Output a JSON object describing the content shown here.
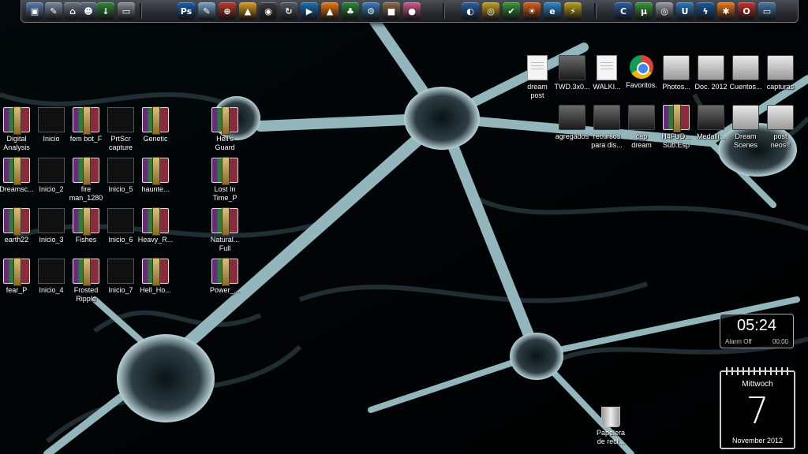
{
  "dock": {
    "icons": [
      {
        "name": "computer-icon",
        "glyph": "▣",
        "color": "#5a7fb0"
      },
      {
        "name": "notes-icon",
        "glyph": "✎",
        "color": "#7a8aa0"
      },
      {
        "name": "network-icon",
        "glyph": "⌂",
        "color": "#6c7480"
      },
      {
        "name": "user-icon",
        "glyph": "☻",
        "color": "#5f6f8a"
      },
      {
        "name": "download-icon",
        "glyph": "↓",
        "color": "#2e8b3a"
      },
      {
        "name": "drive-icon",
        "glyph": "▭",
        "color": "#8a8f96"
      },
      {
        "name": "photoshop-icon",
        "glyph": "Ps",
        "color": "#1b5fb3"
      },
      {
        "name": "notepad-icon",
        "glyph": "✎",
        "color": "#7aa3c8"
      },
      {
        "name": "media-center-icon",
        "glyph": "⊕",
        "color": "#c0392b"
      },
      {
        "name": "aimp-icon",
        "glyph": "▲",
        "color": "#e0a020"
      },
      {
        "name": "eye-icon",
        "glyph": "◉",
        "color": "#3a3a3a"
      },
      {
        "name": "refresh-icon",
        "glyph": "↻",
        "color": "#555b66"
      },
      {
        "name": "play-icon",
        "glyph": "▶",
        "color": "#1e6fb8"
      },
      {
        "name": "vlc-icon",
        "glyph": "▲",
        "color": "#f07b10"
      },
      {
        "name": "frog-icon",
        "glyph": "♣",
        "color": "#2a8a3a"
      },
      {
        "name": "settings-icon",
        "glyph": "⚙",
        "color": "#3a7fc0"
      },
      {
        "name": "box-icon",
        "glyph": "■",
        "color": "#8a6a4a"
      },
      {
        "name": "mushroom-icon",
        "glyph": "●",
        "color": "#d05a8a"
      },
      {
        "name": "google-earth-icon",
        "glyph": "◐",
        "color": "#2a5fa8"
      },
      {
        "name": "chrome-icon",
        "glyph": "◎",
        "color": "#c8a020"
      },
      {
        "name": "bookmark-icon",
        "glyph": "✔",
        "color": "#3a9a3a"
      },
      {
        "name": "firefox-icon",
        "glyph": "☀",
        "color": "#e0601a"
      },
      {
        "name": "internet-explorer-icon",
        "glyph": "e",
        "color": "#2a8ad0"
      },
      {
        "name": "winamp-icon",
        "glyph": "⚡",
        "color": "#c0a020"
      },
      {
        "name": "ccleaner-icon",
        "glyph": "C",
        "color": "#2a5fa0"
      },
      {
        "name": "utorrent-icon",
        "glyph": "µ",
        "color": "#3a9a3a"
      },
      {
        "name": "disc-icon",
        "glyph": "◎",
        "color": "#9a9aaa"
      },
      {
        "name": "ultraiso-icon",
        "glyph": "U",
        "color": "#2a7ac0"
      },
      {
        "name": "lightning-icon",
        "glyph": "ϟ",
        "color": "#1a5aa0"
      },
      {
        "name": "avast-icon",
        "glyph": "✱",
        "color": "#f07a1a"
      },
      {
        "name": "opera-icon",
        "glyph": "O",
        "color": "#d03030"
      },
      {
        "name": "monitor-icon",
        "glyph": "▭",
        "color": "#4a7aa8"
      }
    ]
  },
  "desktop_icons": [
    {
      "name": "icon-digital-analysis",
      "label": "Digital\nAnalysis",
      "kind": "rar"
    },
    {
      "name": "icon-inicio",
      "label": "Inicio",
      "kind": "thumb"
    },
    {
      "name": "icon-fem-bot",
      "label": "fem bot_F",
      "kind": "rar"
    },
    {
      "name": "icon-prtscr-capture",
      "label": "PrtScr\ncapture",
      "kind": "thumb"
    },
    {
      "name": "icon-genetic",
      "label": "Genetic",
      "kind": "rar"
    },
    {
      "name": "icon-hells-guard",
      "label": "Hell's\nGuard",
      "kind": "rar"
    },
    {
      "name": "icon-dreamscene",
      "label": "Dreamsc...",
      "kind": "rar"
    },
    {
      "name": "icon-inicio-2",
      "label": "Inicio_2",
      "kind": "thumb"
    },
    {
      "name": "icon-fire-man",
      "label": "fire\nman_1280",
      "kind": "rar"
    },
    {
      "name": "icon-inicio-5",
      "label": "Inicio_5",
      "kind": "thumb"
    },
    {
      "name": "icon-haunted",
      "label": "haunte...",
      "kind": "rar"
    },
    {
      "name": "icon-lost-in-time",
      "label": "Lost In\nTime_P",
      "kind": "rar"
    },
    {
      "name": "icon-earth22",
      "label": "earth22",
      "kind": "rar"
    },
    {
      "name": "icon-inicio-3",
      "label": "Inicio_3",
      "kind": "thumb"
    },
    {
      "name": "icon-fishes",
      "label": "Fishes",
      "kind": "rar"
    },
    {
      "name": "icon-inicio-6",
      "label": "Inicio_6",
      "kind": "thumb"
    },
    {
      "name": "icon-heavy-r",
      "label": "Heavy_R...",
      "kind": "rar"
    },
    {
      "name": "icon-natural-full",
      "label": "Natural...\nFull",
      "kind": "rar"
    },
    {
      "name": "icon-fear-p",
      "label": "fear_P",
      "kind": "rar"
    },
    {
      "name": "icon-inicio-4",
      "label": "Inicio_4",
      "kind": "thumb"
    },
    {
      "name": "icon-frosted-ripple",
      "label": "Frosted\nRipple",
      "kind": "rar"
    },
    {
      "name": "icon-inicio-7",
      "label": "Inicio_7",
      "kind": "thumb"
    },
    {
      "name": "icon-hell-ho",
      "label": "Hell_Ho...",
      "kind": "rar"
    },
    {
      "name": "icon-power",
      "label": "Power_...",
      "kind": "rar"
    },
    {
      "name": "icon-dream-post",
      "label": "dream\npost",
      "kind": "paper"
    },
    {
      "name": "icon-twd",
      "label": "TWD.3x0...",
      "kind": "folder-dark"
    },
    {
      "name": "icon-walking",
      "label": "WALKI...",
      "kind": "paper"
    },
    {
      "name": "icon-favoritos",
      "label": "Favoritos.",
      "kind": "chrome"
    },
    {
      "name": "icon-photos",
      "label": "Photos...",
      "kind": "folder"
    },
    {
      "name": "icon-doc-2012",
      "label": "Doc. 2012",
      "kind": "folder"
    },
    {
      "name": "icon-cuentos",
      "label": "Cuentos...",
      "kind": "folder"
    },
    {
      "name": "icon-capturas",
      "label": "capturas",
      "kind": "folder"
    },
    {
      "name": "icon-agregados",
      "label": "agregados",
      "kind": "folder-dark"
    },
    {
      "name": "icon-recursos",
      "label": "recursos\npara dis...",
      "kind": "folder-dark"
    },
    {
      "name": "icon-cap-dream",
      "label": "cap\ndream",
      "kind": "folder-dark"
    },
    {
      "name": "icon-h4fud",
      "label": "H4FUD...\nSub.Esp",
      "kind": "rar"
    },
    {
      "name": "icon-medallion",
      "label": "Medalli...",
      "kind": "folder-dark"
    },
    {
      "name": "icon-dream-scenes",
      "label": "Dream\nScenes",
      "kind": "folder"
    },
    {
      "name": "icon-post-neos",
      "label": "post\nneos!!",
      "kind": "folder"
    }
  ],
  "clock": {
    "time": "05:24",
    "alarm_label": "Alarm Off",
    "alarm_time": "00:00"
  },
  "calendar": {
    "weekday": "Mittwoch",
    "day": "7",
    "month_year": "November 2012"
  },
  "recycle_bin": {
    "label": "Papelera\nde reci..."
  }
}
